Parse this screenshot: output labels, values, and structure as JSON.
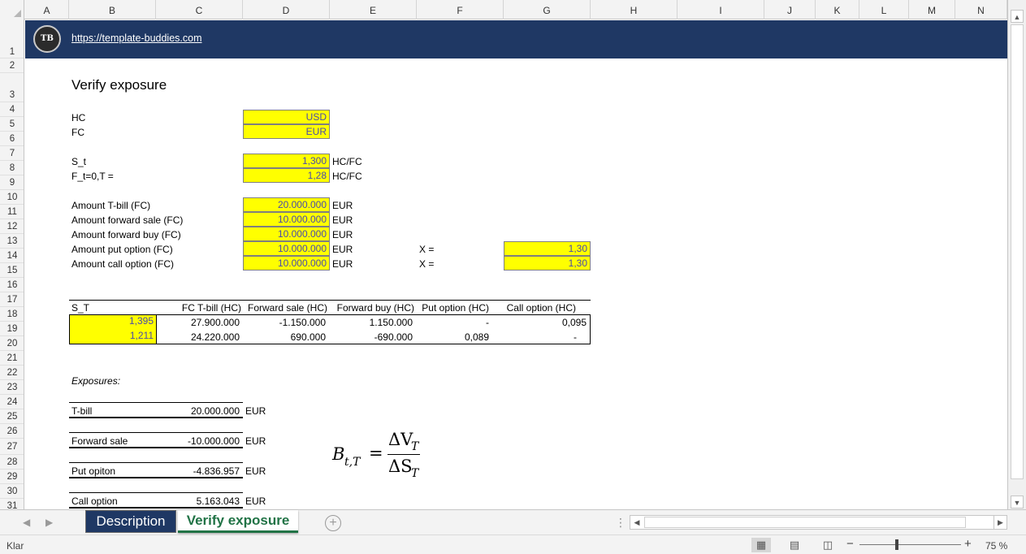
{
  "columns": [
    "A",
    "B",
    "C",
    "D",
    "E",
    "F",
    "G",
    "H",
    "I",
    "J",
    "K",
    "L",
    "M",
    "N"
  ],
  "rows": [
    "1",
    "2",
    "3",
    "4",
    "5",
    "6",
    "7",
    "8",
    "9",
    "10",
    "11",
    "12",
    "13",
    "14",
    "15",
    "16",
    "17",
    "18",
    "19",
    "20",
    "21",
    "22",
    "23",
    "24",
    "25",
    "26",
    "27",
    "28",
    "29",
    "30",
    "31"
  ],
  "banner": {
    "logo_text": "TB",
    "url": "https://template-buddies.com"
  },
  "sheet": {
    "title": "Verify exposure",
    "hc_label": "HC",
    "hc_value": "USD",
    "fc_label": "FC",
    "fc_value": "EUR",
    "st_label": "S_t",
    "st_value": "1,300",
    "st_unit": "HC/FC",
    "ft_label": "F_t=0,T =",
    "ft_value": "1,28",
    "ft_unit": "HC/FC",
    "amounts": [
      {
        "label": "Amount T-bill (FC)",
        "value": "20.000.000",
        "unit": "EUR"
      },
      {
        "label": "Amount forward sale (FC)",
        "value": "10.000.000",
        "unit": "EUR"
      },
      {
        "label": "Amount forward buy (FC)",
        "value": "10.000.000",
        "unit": "EUR"
      },
      {
        "label": "Amount put option (FC)",
        "value": "10.000.000",
        "unit": "EUR"
      },
      {
        "label": "Amount call option (FC)",
        "value": "10.000.000",
        "unit": "EUR"
      }
    ],
    "strike_label": "X =",
    "strike_put": "1,30",
    "strike_call": "1,30",
    "table": {
      "headers": [
        "S_T",
        "FC T-bill (HC)",
        "Forward sale (HC)",
        "Forward buy (HC)",
        "Put option (HC)",
        "Call option (HC)"
      ],
      "rows": [
        [
          "1,395",
          "27.900.000",
          "-1.150.000",
          "1.150.000",
          "-",
          "0,095"
        ],
        [
          "1,211",
          "24.220.000",
          "690.000",
          "-690.000",
          "0,089",
          "-"
        ]
      ]
    },
    "exposures_title": "Exposures:",
    "exposures": [
      {
        "label": "T-bill",
        "value": "20.000.000",
        "unit": "EUR"
      },
      {
        "label": "Forward sale",
        "value": "-10.000.000",
        "unit": "EUR"
      },
      {
        "label": "Put opiton",
        "value": "-4.836.957",
        "unit": "EUR"
      },
      {
        "label": "Call option",
        "value": "5.163.043",
        "unit": "EUR"
      }
    ],
    "formula": {
      "lhs": "B",
      "lhs_sub": "t,T",
      "num": "ΔV",
      "num_sub": "T",
      "den": "ΔS",
      "den_sub": "T"
    }
  },
  "tabs": [
    {
      "label": "Description",
      "active": false
    },
    {
      "label": "Verify exposure",
      "active": true
    }
  ],
  "status": {
    "text": "Klar",
    "zoom": "75 %"
  },
  "colors": {
    "banner": "#1f3864",
    "input_fill": "#ffff00",
    "active_tab": "#217346"
  }
}
